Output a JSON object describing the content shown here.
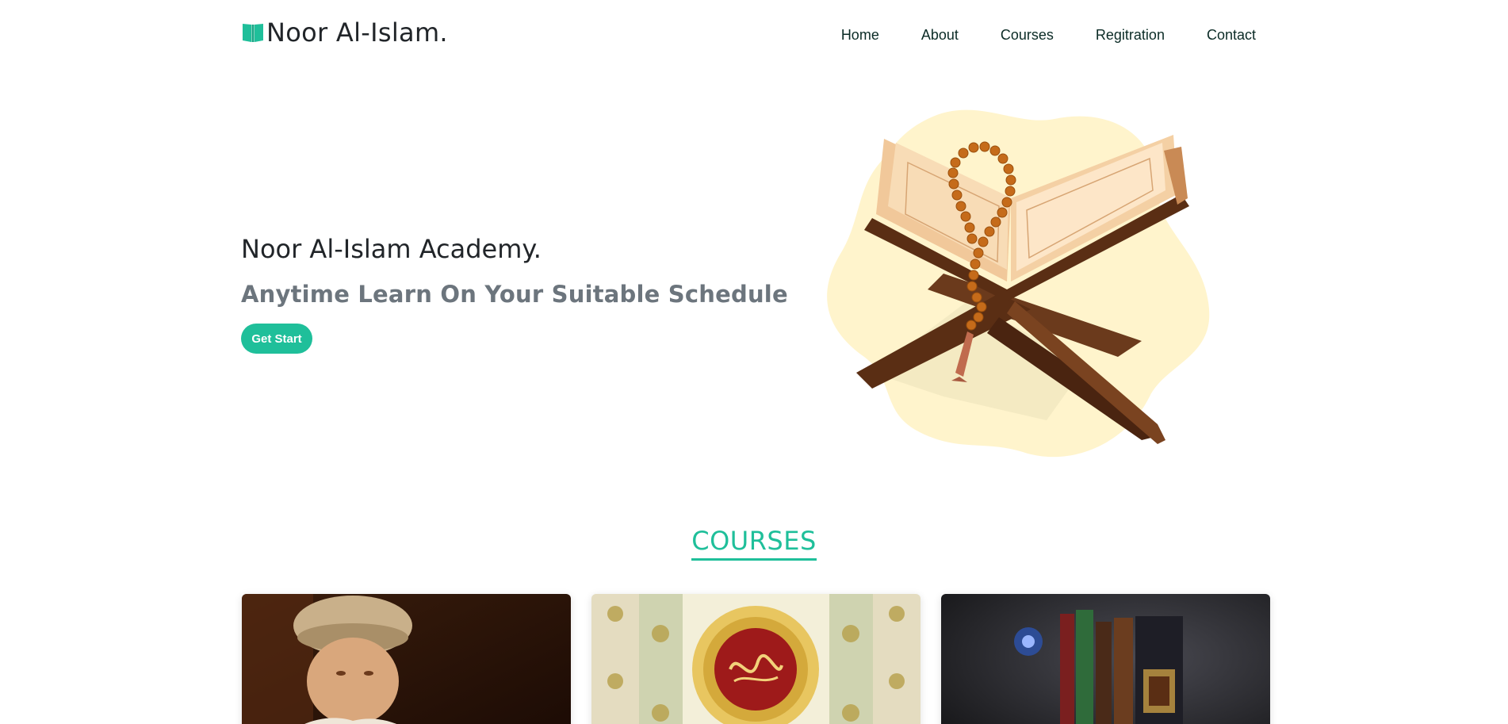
{
  "brand": {
    "name": "Noor Al-Islam.",
    "icon": "open-book-icon"
  },
  "nav": {
    "items": [
      {
        "label": "Home"
      },
      {
        "label": "About"
      },
      {
        "label": "Courses"
      },
      {
        "label": "Regitration"
      },
      {
        "label": "Contact"
      }
    ]
  },
  "hero": {
    "title": "Noor Al-Islam Academy.",
    "subtitle": "Anytime Learn On Your Suitable Schedule",
    "cta_label": "Get Start",
    "illustration": "quran-on-stand-with-prayer-beads"
  },
  "courses": {
    "heading": "COURSES",
    "cards": [
      {
        "image": "boy-reading-quran"
      },
      {
        "image": "quran-calligraphy-ornament"
      },
      {
        "image": "islamic-books-with-lamp"
      }
    ]
  },
  "colors": {
    "accent": "#1fbf9a",
    "text_dark": "#212529",
    "text_muted": "#6c757d",
    "blob": "#fff4cc"
  }
}
